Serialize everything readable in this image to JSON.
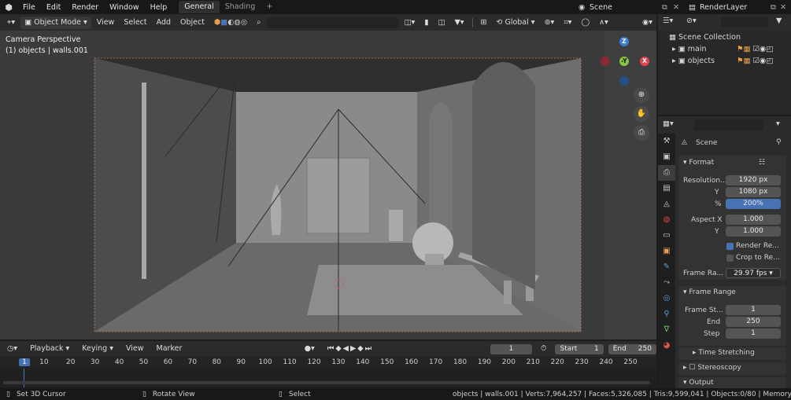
{
  "topbar": {
    "menus": [
      "File",
      "Edit",
      "Render",
      "Window",
      "Help"
    ],
    "workspace_tabs": [
      "General",
      "Shading"
    ],
    "active_tab": "General",
    "add_tab": "+",
    "scene": "Scene",
    "view_layer": "RenderLayer"
  },
  "viewport_header": {
    "mode": "Object Mode",
    "menus": [
      "View",
      "Select",
      "Add",
      "Object"
    ],
    "orientation": "Global"
  },
  "viewport": {
    "view_name": "Camera Perspective",
    "object_info": "(1) objects | walls.001",
    "gizmo": {
      "z": "Z",
      "y": "-Y",
      "x": "X"
    }
  },
  "outliner": {
    "collection": "Scene Collection",
    "items": [
      {
        "label": "main"
      },
      {
        "label": "objects"
      }
    ]
  },
  "properties": {
    "object_name": "Scene",
    "format": {
      "title": "Format",
      "resolution_label": "Resolution...",
      "res_x": "1920 px",
      "y_label": "Y",
      "res_y": "1080 px",
      "pct_label": "%",
      "pct": "200%",
      "aspect_label": "Aspect X",
      "aspect_x": "1.000",
      "aspect_y_label": "Y",
      "aspect_y": "1.000",
      "render_region": "Render Re...",
      "crop": "Crop to Re...",
      "frame_rate_label": "Frame Ra...",
      "frame_rate": "29.97 fps"
    },
    "frame_range": {
      "title": "Frame Range",
      "start_label": "Frame St...",
      "start": "1",
      "end_label": "End",
      "end": "250",
      "step_label": "Step",
      "step": "1"
    },
    "time_stretching": "Time Stretching",
    "stereoscopy": "Stereoscopy",
    "output": "Output"
  },
  "timeline": {
    "menus": [
      "Playback",
      "Keying",
      "View",
      "Marker"
    ],
    "current_frame": "1",
    "start_label": "Start",
    "start": "1",
    "end_label": "End",
    "end": "250",
    "ruler": [
      "1",
      "10",
      "20",
      "30",
      "40",
      "50",
      "60",
      "70",
      "80",
      "90",
      "100",
      "110",
      "120",
      "130",
      "140",
      "150",
      "160",
      "170",
      "180",
      "190",
      "200",
      "210",
      "220",
      "230",
      "240",
      "250"
    ]
  },
  "statusbar": {
    "hint1": "Set 3D Cursor",
    "hint2": "Rotate View",
    "hint3": "Select",
    "stats": "objects | walls.001 | Verts:7,964,257 | Faces:5,326,085 | Tris:9,599,041 | Objects:0/80 | Memory: 1.71"
  },
  "colors": {
    "accent": "#4772b3",
    "x_axis": "#e2434d",
    "y_axis": "#8bc43f",
    "z_axis": "#3b7fd3"
  }
}
